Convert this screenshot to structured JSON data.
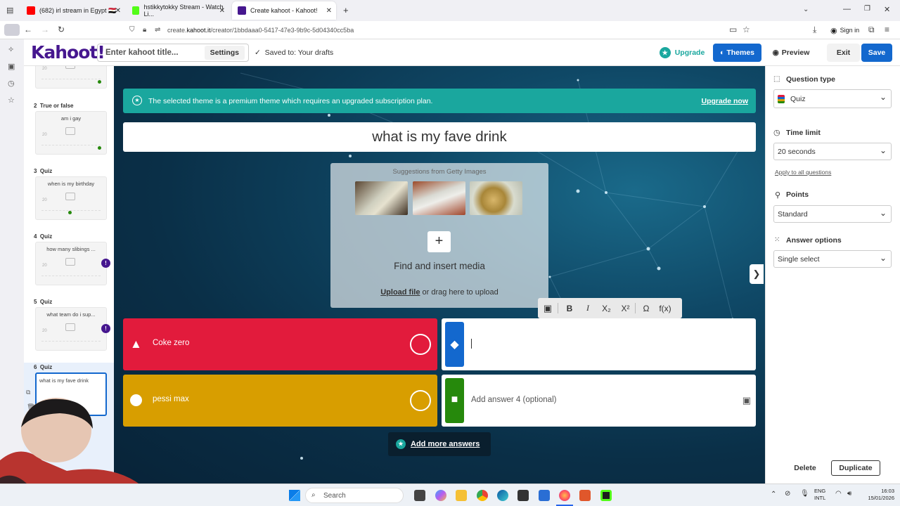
{
  "browser": {
    "tabs": [
      {
        "title": "(682) irl stream in Egypt 🇪🇬",
        "favicon_color": "#ff0000"
      },
      {
        "title": "hstikkytokky Stream - Watch Li...",
        "favicon_color": "#53fc18"
      },
      {
        "title": "Create kahoot - Kahoot!",
        "favicon_color": "#46178f"
      }
    ],
    "new_tab": "+",
    "url_prefix": "create.",
    "url_domain": "kahoot.it",
    "url_path": "/creator/1bbdaaa0-5417-47e3-9b9c-5d04340cc5ba",
    "sign_in": "Sign in"
  },
  "kahoot_header": {
    "logo": "Kahoot!",
    "title_placeholder": "Enter kahoot title...",
    "settings": "Settings",
    "saved": "Saved to: Your drafts",
    "upgrade": "Upgrade",
    "themes": "Themes",
    "preview": "Preview",
    "exit": "Exit",
    "save": "Save"
  },
  "slides": [
    {
      "num": "",
      "type": "",
      "title": ""
    },
    {
      "num": "2",
      "type": "True or false",
      "title": "am i gay"
    },
    {
      "num": "3",
      "type": "Quiz",
      "title": "when is my birthday"
    },
    {
      "num": "4",
      "type": "Quiz",
      "title": "how many slibings ..."
    },
    {
      "num": "5",
      "type": "Quiz",
      "title": "what team do i sup..."
    },
    {
      "num": "6",
      "type": "Quiz",
      "title": "what is my fave drink"
    }
  ],
  "thumb_time": "20",
  "editor": {
    "banner": "The selected theme is a premium theme which requires an upgraded subscription plan.",
    "upgrade_now": "Upgrade now",
    "question": "what is my fave drink",
    "suggestions": "Suggestions from Getty Images",
    "find_media": "Find and insert media",
    "upload_file": "Upload file",
    "upload_rest": "or drag here to upload",
    "toolbar": {
      "bold": "B",
      "italic": "I",
      "sub": "X₂",
      "sup": "X²",
      "omega": "Ω",
      "fx": "f(x)"
    },
    "answers": [
      {
        "text": "Coke zero",
        "color": "#e21b3c"
      },
      {
        "text": "",
        "placeholder": "",
        "color": "#1368ce"
      },
      {
        "text": "pessi max",
        "color": "#d89e00"
      },
      {
        "text": "",
        "placeholder": "Add answer 4 (optional)",
        "color": "#26890c"
      }
    ],
    "add_more": "Add more answers"
  },
  "right_panel": {
    "question_type_label": "Question type",
    "question_type": "Quiz",
    "time_limit_label": "Time limit",
    "time_limit": "20 seconds",
    "apply_all": "Apply to all questions",
    "points_label": "Points",
    "points": "Standard",
    "answer_options_label": "Answer options",
    "answer_options": "Single select",
    "delete": "Delete",
    "duplicate": "Duplicate"
  },
  "taskbar": {
    "search": "Search",
    "lang_top": "ENG",
    "lang_bottom": "INTL",
    "time": "16:03",
    "date": "15/01/2026"
  }
}
